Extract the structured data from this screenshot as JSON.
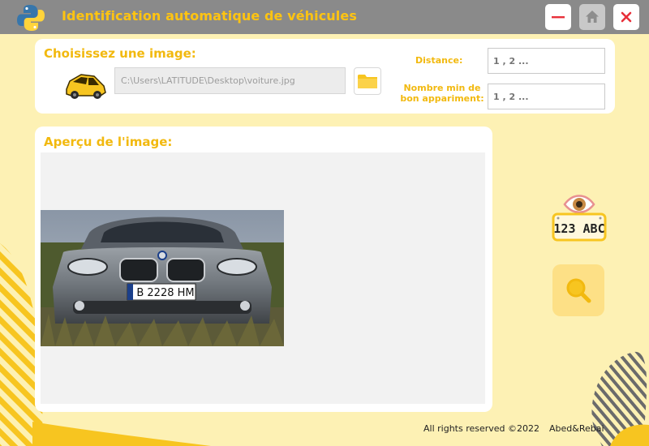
{
  "window": {
    "title": "Identification automatique de véhicules",
    "icons": {
      "logo": "python-logo-icon",
      "minimize": "minimize-icon",
      "home": "home-icon",
      "close": "close-icon"
    }
  },
  "image_section": {
    "title": "Choisissez une image:",
    "path_value": "C:\\Users\\LATITUDE\\Desktop\\voiture.jpg",
    "icons": {
      "car": "car-icon",
      "browse": "folder-icon"
    }
  },
  "params": {
    "distance": {
      "label": "Distance:",
      "placeholder": "1 , 2 ..."
    },
    "min_match": {
      "label_line1": "Nombre min de",
      "label_line2": "bon appariment:",
      "placeholder": "1 , 2 ..."
    }
  },
  "preview": {
    "title": "Aperçu de l'image:",
    "plate_text": "B 2228 HM"
  },
  "actions": {
    "plate_badge_text": "123 ABC",
    "icons": {
      "plate": "plate-eye-icon",
      "search": "search-icon"
    }
  },
  "footer": {
    "rights": "All rights reserved ©2022",
    "author": "Abed&Rebai"
  },
  "colors": {
    "accent": "#f2b90f",
    "background": "#fdf1b4",
    "titlebar": "#8a8a8a",
    "close_red": "#e8303a"
  }
}
